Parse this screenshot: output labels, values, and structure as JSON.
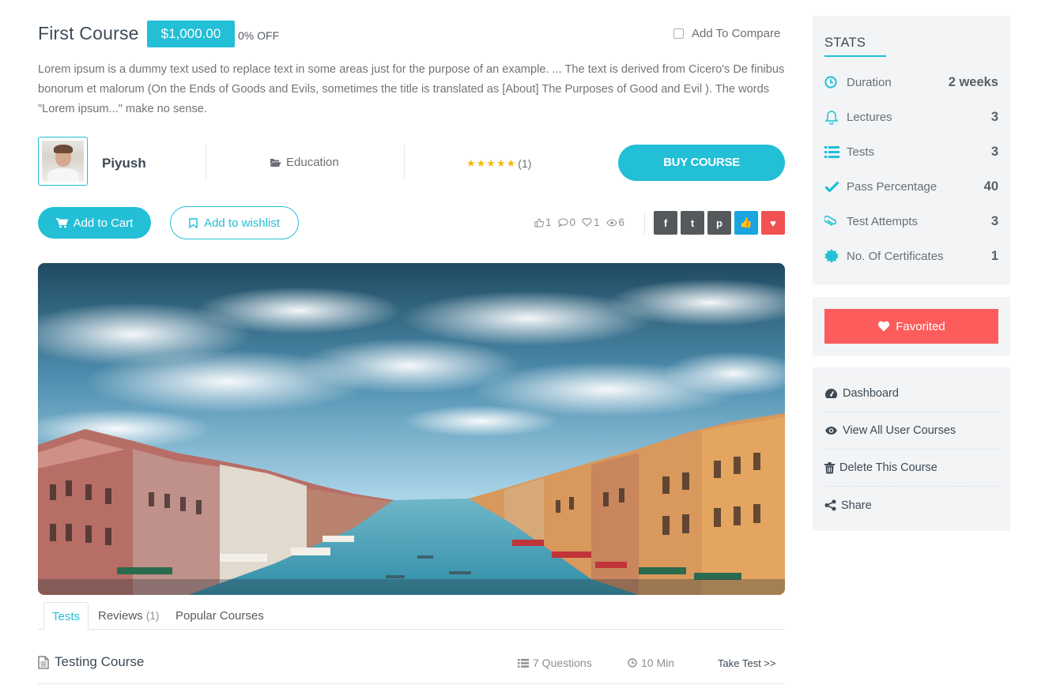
{
  "course": {
    "title": "First Course",
    "price": "$1,000.00",
    "discount": "0% OFF",
    "compare_label": "Add To Compare",
    "description": "Lorem ipsum is a dummy text used to replace text in some areas just for the purpose of an example. ... The text is derived from Cicero's De finibus bonorum et malorum (On the Ends of Goods and Evils, sometimes the title is translated as [About] The Purposes of Good and Evil ). The words \"Lorem ipsum...\" make no sense."
  },
  "meta": {
    "author": "Piyush",
    "category": "Education",
    "stars": "★★★★★",
    "rating_count": "(1)",
    "buy_label": "BUY COURSE"
  },
  "actions": {
    "cart_label": "Add to Cart",
    "wishlist_label": "Add to wishlist",
    "likes": "1",
    "comments": "0",
    "favorites": "1",
    "views": "6",
    "share_icons": [
      "facebook-icon",
      "twitter-icon",
      "pinterest-icon",
      "like-icon",
      "heart-icon"
    ],
    "share_glyphs": [
      "f",
      "t",
      "p",
      "👍",
      "♥"
    ]
  },
  "tabs": [
    {
      "label": "Tests"
    },
    {
      "label": "Reviews",
      "count": "(1)"
    },
    {
      "label": "Popular Courses"
    }
  ],
  "test": {
    "title": "Testing Course",
    "questions": "7 Questions",
    "duration": "10 Min",
    "action": "Take Test >>"
  },
  "stats": {
    "heading": "STATS",
    "rows": [
      {
        "label": "Duration",
        "value": "2 weeks",
        "icon": "clock-icon"
      },
      {
        "label": "Lectures",
        "value": "3",
        "icon": "bell-icon"
      },
      {
        "label": "Tests",
        "value": "3",
        "icon": "list-icon"
      },
      {
        "label": "Pass Percentage",
        "value": "40",
        "icon": "check-icon"
      },
      {
        "label": "Test Attempts",
        "value": "3",
        "icon": "paperclip-icon"
      },
      {
        "label": "No. Of Certificates",
        "value": "1",
        "icon": "certificate-icon"
      }
    ]
  },
  "favorite": {
    "label": "Favorited"
  },
  "links": [
    {
      "label": "Dashboard",
      "icon": "dashboard-icon"
    },
    {
      "label": "View All User Courses",
      "icon": "eye-icon"
    },
    {
      "label": "Delete This Course",
      "icon": "trash-icon"
    },
    {
      "label": "Share",
      "icon": "share-icon"
    }
  ],
  "colors": {
    "accent": "#22bfd6",
    "favorite": "#fd5c5c",
    "star": "#f5b90a",
    "sidebar_bg": "#f2f4f6"
  }
}
